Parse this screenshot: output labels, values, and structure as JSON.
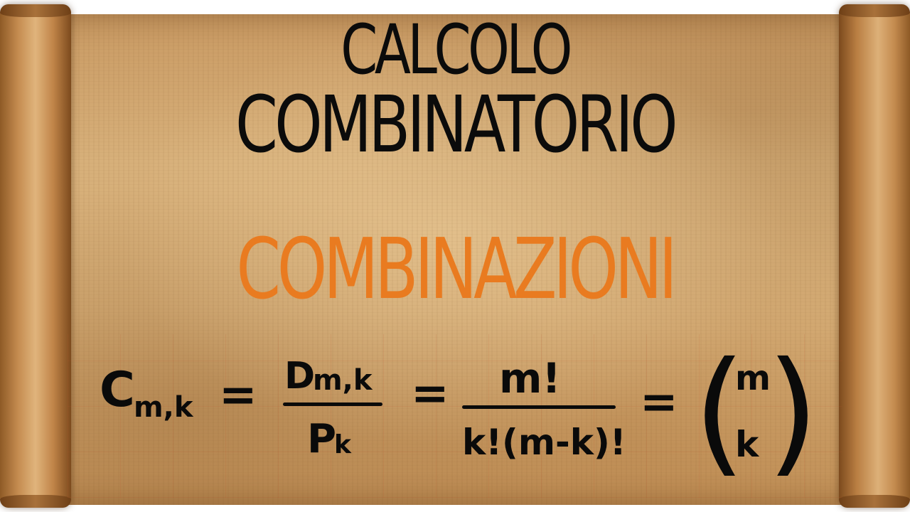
{
  "title": {
    "line1": "CALCOLO",
    "line2": "COMBINATORIO"
  },
  "subtitle": "COMBINAZIONI",
  "formula": {
    "lhs_symbol": "C",
    "lhs_subscript": "m,k",
    "fraction1_numerator_symbol": "D",
    "fraction1_numerator_subscript": "m,k",
    "fraction1_denominator_symbol": "P",
    "fraction1_denominator_subscript": "k",
    "fraction2_numerator": "m!",
    "fraction2_denominator": "k!(m-k)!",
    "binomial_top": "m",
    "binomial_bottom": "k",
    "equals": "="
  },
  "colors": {
    "title": "#0b0b0b",
    "subtitle": "#e97b20",
    "parchment": "#d6ad76"
  }
}
